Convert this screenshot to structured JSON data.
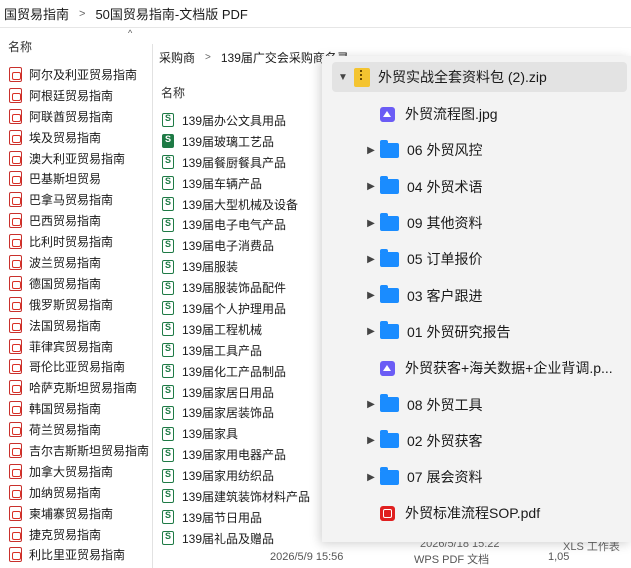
{
  "back_window": {
    "breadcrumb": [
      "国贸易指南",
      "50国贸易指南-文档版 PDF"
    ],
    "column_name": "名称",
    "files": [
      "阿尔及利亚贸易指南",
      "阿根廷贸易指南",
      "阿联酋贸易指南",
      "埃及贸易指南",
      "澳大利亚贸易指南",
      "巴基斯坦贸易",
      "巴拿马贸易指南",
      "巴西贸易指南",
      "比利时贸易指南",
      "波兰贸易指南",
      "德国贸易指南",
      "俄罗斯贸易指南",
      "法国贸易指南",
      "菲律宾贸易指南",
      "哥伦比亚贸易指南",
      "哈萨克斯坦贸易指南",
      "韩国贸易指南",
      "荷兰贸易指南",
      "吉尔吉斯斯坦贸易指南",
      "加拿大贸易指南",
      "加纳贸易指南",
      "柬埔寨贸易指南",
      "捷克贸易指南",
      "利比里亚贸易指南"
    ]
  },
  "middle_window": {
    "breadcrumb": [
      "采购商",
      "139届广交会采购商名录"
    ],
    "column_name": "名称",
    "files": [
      "139届办公文具用品",
      "139届玻璃工艺品",
      "139届餐厨餐具产品",
      "139届车辆产品",
      "139届大型机械及设备",
      "139届电子电气产品",
      "139届电子消费品",
      "139届服装",
      "139届服装饰品配件",
      "139届个人护理用品",
      "139届工程机械",
      "139届工具产品",
      "139届化工产品制品",
      "139届家居日用品",
      "139届家居装饰品",
      "139届家具",
      "139届家用电器产品",
      "139届家用纺织品",
      "139届建筑装饰材料产品",
      "139届节日用品",
      "139届礼品及赠品"
    ],
    "bottom_date": "2026/5/9 15:56",
    "bottom_type": "WPS PDF 文档",
    "peek_date": "2026/5/18 15:22",
    "peek_type": "XLS 工作表",
    "peek_size": "1,05"
  },
  "zip_window": {
    "archive_name": "外贸实战全套资料包 (2).zip",
    "items": [
      {
        "kind": "image",
        "label": "外贸流程图.jpg",
        "expandable": false
      },
      {
        "kind": "folder",
        "label": "06 外贸风控",
        "expandable": true
      },
      {
        "kind": "folder",
        "label": "04 外贸术语",
        "expandable": true
      },
      {
        "kind": "folder",
        "label": "09 其他资料",
        "expandable": true
      },
      {
        "kind": "folder",
        "label": "05 订单报价",
        "expandable": true
      },
      {
        "kind": "folder",
        "label": "03 客户跟进",
        "expandable": true
      },
      {
        "kind": "folder",
        "label": "01 外贸研究报告",
        "expandable": true
      },
      {
        "kind": "image",
        "label": "外贸获客+海关数据+企业背调.p...",
        "expandable": false
      },
      {
        "kind": "folder",
        "label": "08 外贸工具",
        "expandable": true
      },
      {
        "kind": "folder",
        "label": "02 外贸获客",
        "expandable": true
      },
      {
        "kind": "folder",
        "label": "07 展会资料",
        "expandable": true
      },
      {
        "kind": "pdf",
        "label": "外贸标准流程SOP.pdf",
        "expandable": false
      }
    ]
  }
}
